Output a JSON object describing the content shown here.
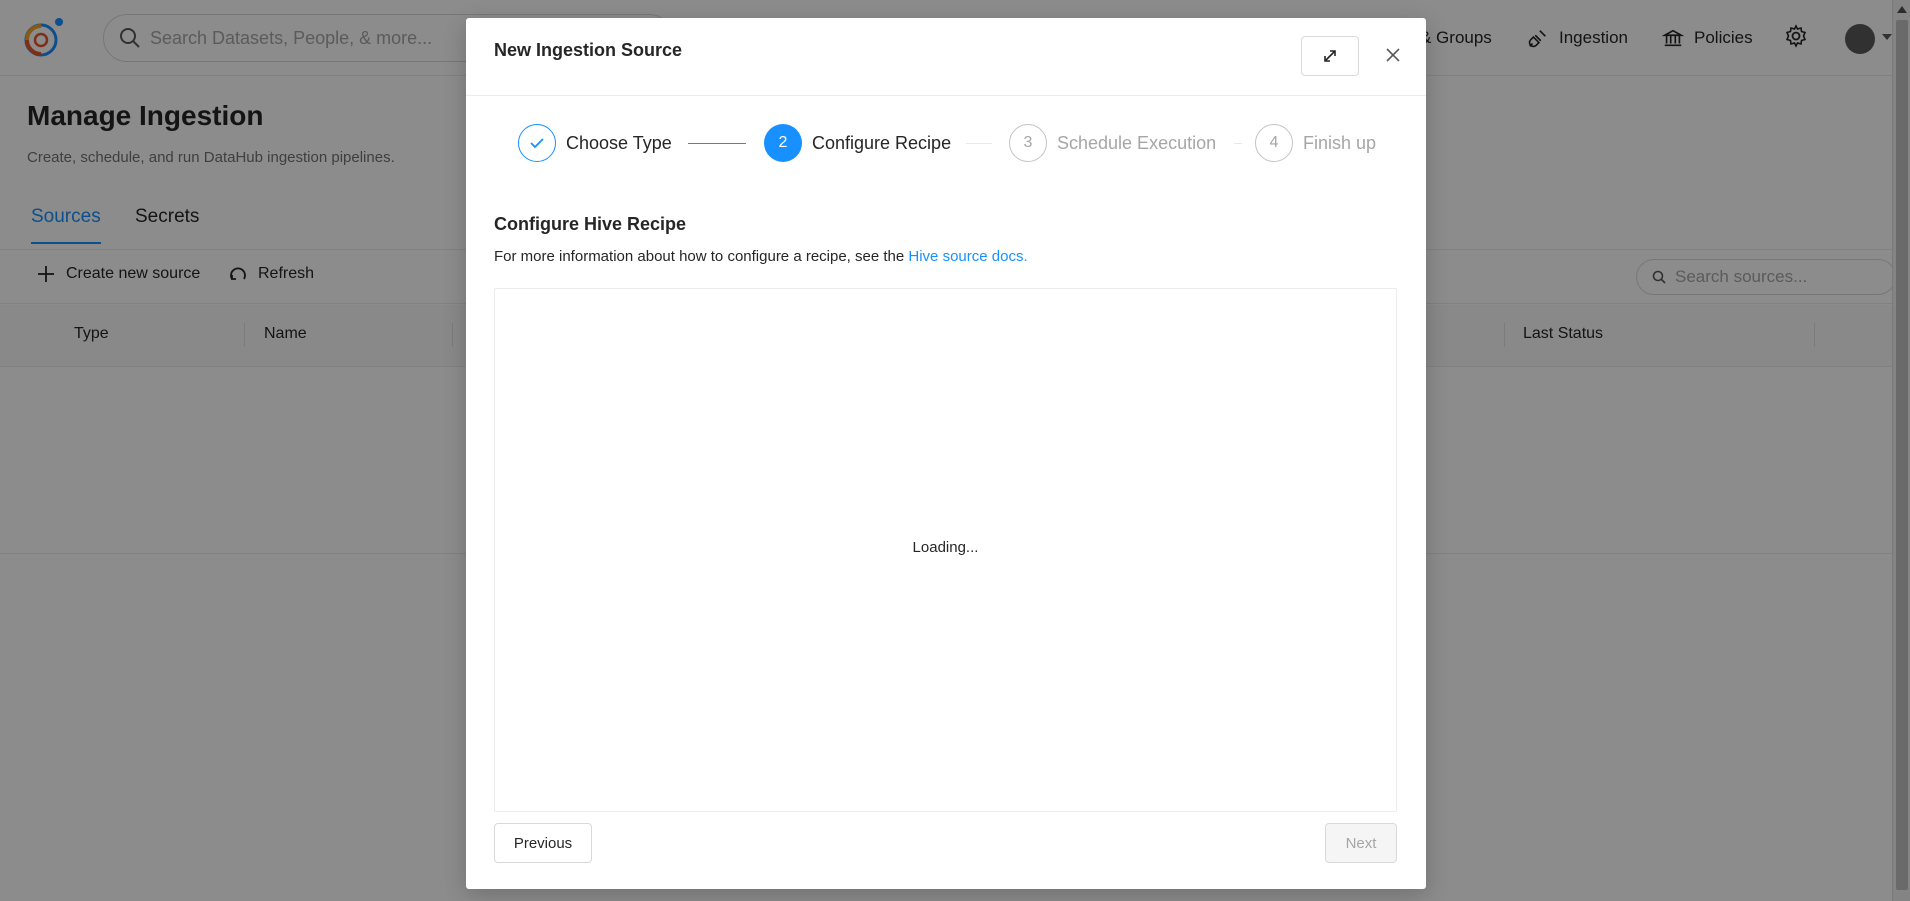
{
  "header": {
    "search_placeholder": "Search Datasets, People, & more...",
    "nav": [
      {
        "label": "& Groups",
        "icon": "users-icon"
      },
      {
        "label": "Ingestion",
        "icon": "plug-icon"
      },
      {
        "label": "Policies",
        "icon": "bank-icon"
      }
    ]
  },
  "page": {
    "title": "Manage Ingestion",
    "subtitle": "Create, schedule, and run DataHub ingestion pipelines.",
    "tabs": [
      {
        "label": "Sources",
        "active": true
      },
      {
        "label": "Secrets",
        "active": false
      }
    ],
    "actions": {
      "create_label": "Create new source",
      "refresh_label": "Refresh",
      "search_placeholder": "Search sources..."
    },
    "table": {
      "columns": [
        "Type",
        "Name",
        "Last Status"
      ]
    }
  },
  "modal": {
    "title": "New Ingestion Source",
    "steps": [
      {
        "number": "1",
        "label": "Choose Type",
        "status": "done"
      },
      {
        "number": "2",
        "label": "Configure Recipe",
        "status": "active"
      },
      {
        "number": "3",
        "label": "Schedule Execution",
        "status": "pending"
      },
      {
        "number": "4",
        "label": "Finish up",
        "status": "pending"
      }
    ],
    "section_title": "Configure Hive Recipe",
    "section_desc": "For more information about how to configure a recipe, see the ",
    "docs_link": "Hive source docs.",
    "loading_text": "Loading...",
    "previous_label": "Previous",
    "next_label": "Next"
  },
  "colors": {
    "accent": "#1890ff",
    "overlay": "rgba(0,0,0,0.45)"
  }
}
